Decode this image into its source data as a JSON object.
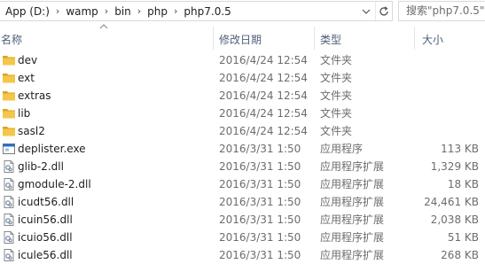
{
  "address": {
    "crumbs": [
      "App (D:)",
      "wamp",
      "bin",
      "php",
      "php7.0.5"
    ],
    "separator": "›"
  },
  "search": {
    "placeholder": "搜索\"php7.0.5\""
  },
  "columns": {
    "name": "名称",
    "date": "修改日期",
    "type": "类型",
    "size": "大小"
  },
  "files": [
    {
      "name": "dev",
      "date": "2016/4/24 12:54",
      "type": "文件夹",
      "size": "",
      "icon": "folder-icon"
    },
    {
      "name": "ext",
      "date": "2016/4/24 12:54",
      "type": "文件夹",
      "size": "",
      "icon": "folder-icon"
    },
    {
      "name": "extras",
      "date": "2016/4/24 12:54",
      "type": "文件夹",
      "size": "",
      "icon": "folder-icon"
    },
    {
      "name": "lib",
      "date": "2016/4/24 12:54",
      "type": "文件夹",
      "size": "",
      "icon": "folder-icon"
    },
    {
      "name": "sasl2",
      "date": "2016/4/24 12:54",
      "type": "文件夹",
      "size": "",
      "icon": "folder-icon"
    },
    {
      "name": "deplister.exe",
      "date": "2016/3/31 1:50",
      "type": "应用程序",
      "size": "113 KB",
      "icon": "exe-icon"
    },
    {
      "name": "glib-2.dll",
      "date": "2016/3/31 1:50",
      "type": "应用程序扩展",
      "size": "1,329 KB",
      "icon": "dll-icon"
    },
    {
      "name": "gmodule-2.dll",
      "date": "2016/3/31 1:50",
      "type": "应用程序扩展",
      "size": "18 KB",
      "icon": "dll-icon"
    },
    {
      "name": "icudt56.dll",
      "date": "2016/3/31 1:50",
      "type": "应用程序扩展",
      "size": "24,461 KB",
      "icon": "dll-icon"
    },
    {
      "name": "icuin56.dll",
      "date": "2016/3/31 1:50",
      "type": "应用程序扩展",
      "size": "2,038 KB",
      "icon": "dll-icon"
    },
    {
      "name": "icuio56.dll",
      "date": "2016/3/31 1:50",
      "type": "应用程序扩展",
      "size": "51 KB",
      "icon": "dll-icon"
    },
    {
      "name": "icule56.dll",
      "date": "2016/3/31 1:50",
      "type": "应用程序扩展",
      "size": "268 KB",
      "icon": "dll-icon"
    }
  ],
  "colors": {
    "folder": "#f4c64a",
    "folder_dark": "#d9a520",
    "header_text": "#4c607a",
    "exe_blue": "#2b6cc4"
  }
}
